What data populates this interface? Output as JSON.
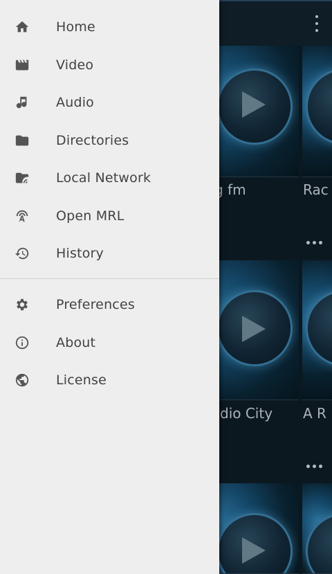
{
  "drawer": {
    "primary_items": [
      {
        "label": "Home",
        "icon": "home-icon"
      },
      {
        "label": "Video",
        "icon": "movie-icon"
      },
      {
        "label": "Audio",
        "icon": "music-note-icon"
      },
      {
        "label": "Directories",
        "icon": "folder-icon"
      },
      {
        "label": "Local Network",
        "icon": "network-folder-icon"
      },
      {
        "label": "Open MRL",
        "icon": "broadcast-icon"
      },
      {
        "label": "History",
        "icon": "history-icon"
      }
    ],
    "secondary_items": [
      {
        "label": "Preferences",
        "icon": "gear-icon"
      },
      {
        "label": "About",
        "icon": "info-icon"
      },
      {
        "label": "License",
        "icon": "globe-icon"
      }
    ]
  },
  "background": {
    "cards": [
      {
        "title": "g fm"
      },
      {
        "title": "Rac"
      },
      {
        "title": "dio City"
      },
      {
        "title": "A R"
      }
    ]
  },
  "colors": {
    "drawer_bg": "#eeeeee",
    "label_text": "#424242",
    "icon": "#555555",
    "background_app": "#0e1c25"
  }
}
